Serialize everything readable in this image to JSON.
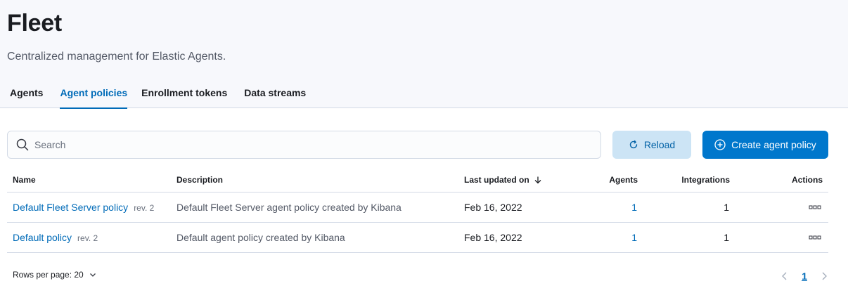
{
  "header": {
    "title": "Fleet",
    "subtitle": "Centralized management for Elastic Agents."
  },
  "tabs": [
    {
      "label": "Agents",
      "selected": false
    },
    {
      "label": "Agent policies",
      "selected": true
    },
    {
      "label": "Enrollment tokens",
      "selected": false
    },
    {
      "label": "Data streams",
      "selected": false
    }
  ],
  "toolbar": {
    "search_placeholder": "Search",
    "search_value": "",
    "reload_label": "Reload",
    "create_label": "Create agent policy"
  },
  "table": {
    "columns": {
      "name": "Name",
      "description": "Description",
      "last_updated": "Last updated on",
      "agents": "Agents",
      "integrations": "Integrations",
      "actions": "Actions"
    },
    "sort": {
      "column": "last_updated",
      "direction": "descending"
    },
    "rows": [
      {
        "name": "Default Fleet Server policy",
        "revision": "rev. 2",
        "description": "Default Fleet Server agent policy created by Kibana",
        "last_updated": "Feb 16, 2022",
        "agents": "1",
        "integrations": "1"
      },
      {
        "name": "Default policy",
        "revision": "rev. 2",
        "description": "Default agent policy created by Kibana",
        "last_updated": "Feb 16, 2022",
        "agents": "1",
        "integrations": "1"
      }
    ]
  },
  "footer": {
    "rows_per_page_label": "Rows per page: 20",
    "current_page": "1"
  },
  "colors": {
    "accent": "#0077cc",
    "link": "#006bb8",
    "header_bg": "#f7f8fc",
    "border": "#d3dae6"
  },
  "icons": {
    "search": "search-icon",
    "reload": "refresh-icon",
    "create": "plus-in-circle-icon",
    "sort": "arrow-down-icon",
    "actions": "boxes-horizontal-icon",
    "rows_dropdown": "chevron-down-icon",
    "prev": "chevron-left-icon",
    "next": "chevron-right-icon"
  }
}
